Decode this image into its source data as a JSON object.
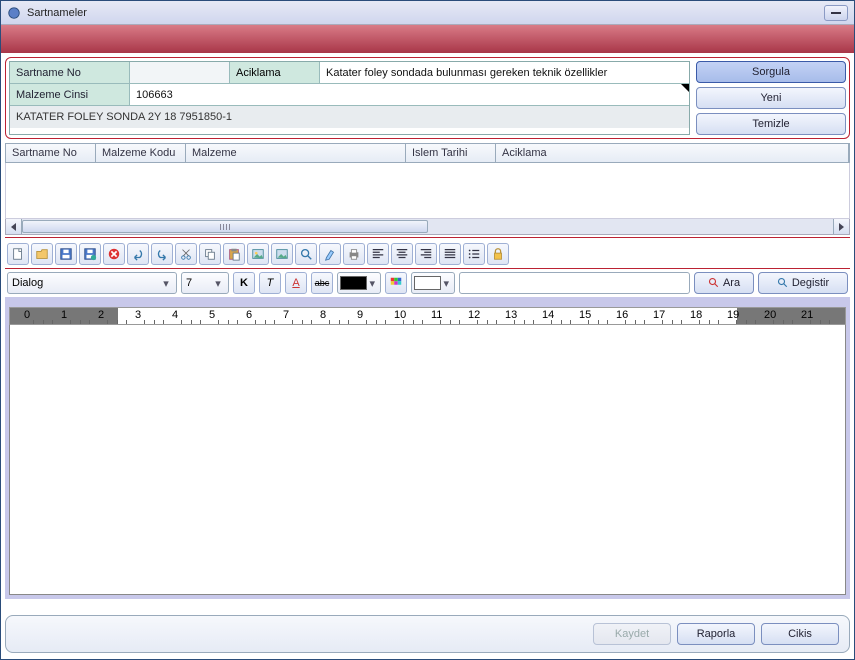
{
  "window": {
    "title": "Sartnameler"
  },
  "search": {
    "sartname_no_label": "Sartname No",
    "aciklama_label": "Aciklama",
    "aciklama_value": "Katater foley sondada bulunması gereken teknik özellikler",
    "malzeme_cinsi_label": "Malzeme Cinsi",
    "malzeme_cinsi_value": "106663",
    "detail_value": "KATATER FOLEY SONDA 2Y 18 7951850-1"
  },
  "side_buttons": {
    "sorgula": "Sorgula",
    "yeni": "Yeni",
    "temizle": "Temizle"
  },
  "grid": {
    "cols": {
      "sartname_no": "Sartname No",
      "malzeme_kodu": "Malzeme Kodu",
      "malzeme": "Malzeme",
      "islem_tarihi": "Islem Tarihi",
      "aciklama": "Aciklama"
    }
  },
  "format": {
    "font": "Dialog",
    "size": "7",
    "bold": "K",
    "italic": "T",
    "underline": "A",
    "strike": "abc"
  },
  "searchbar": {
    "ara": "Ara",
    "degistir": "Degistir"
  },
  "ruler": {
    "marks": [
      "0",
      "1",
      "2",
      "3",
      "4",
      "5",
      "6",
      "7",
      "8",
      "9",
      "10",
      "11",
      "12",
      "13",
      "14",
      "15",
      "16",
      "17",
      "18",
      "19",
      "20",
      "21"
    ]
  },
  "bottom": {
    "kaydet": "Kaydet",
    "raporla": "Raporla",
    "cikis": "Cikis"
  }
}
